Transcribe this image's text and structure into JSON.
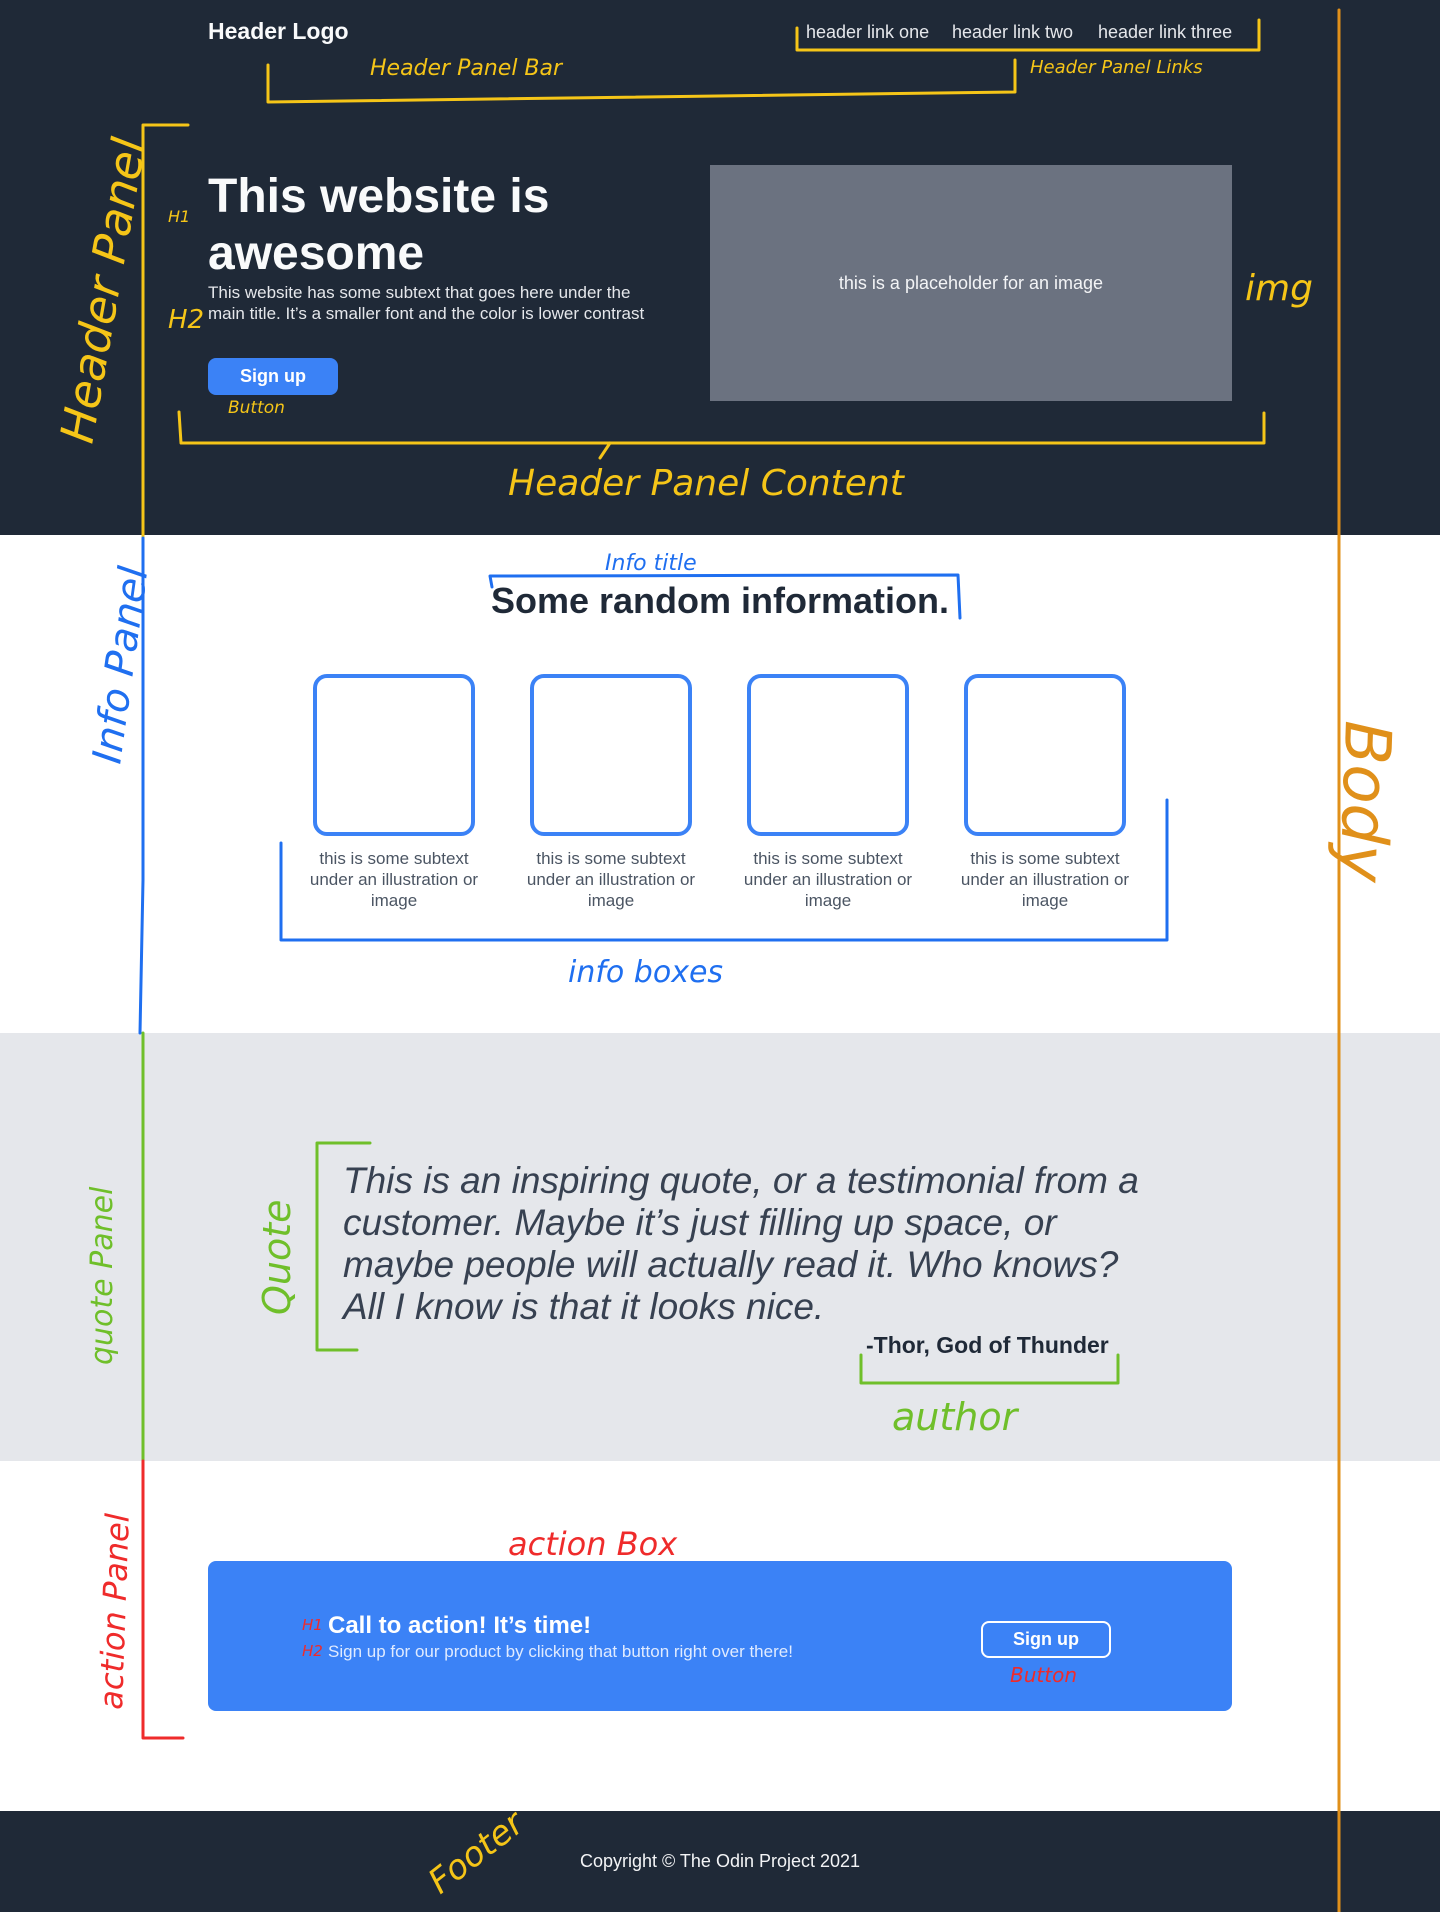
{
  "header": {
    "logo": "Header Logo",
    "links": [
      "header link one",
      "header link two",
      "header link three"
    ]
  },
  "hero": {
    "title": "This website is awesome",
    "subtitle": "This website has some subtext that goes here under the main title.  It’s a smaller font and the color is lower contrast",
    "button_label": "Sign up",
    "image_placeholder": "this is a placeholder for an image"
  },
  "info": {
    "title": "Some random information.",
    "captions": [
      "this is some subtext under an illustration or image",
      "this is some subtext under an illustration or image",
      "this is some subtext under an illustration or image",
      "this is some subtext under an illustration or image"
    ]
  },
  "quote": {
    "text": "This is an inspiring quote, or a testimonial from a customer.  Maybe it’s just filling up space, or maybe people will actually read it. Who knows?  All I know is that it looks nice.",
    "author": "-Thor, God of Thunder"
  },
  "cta": {
    "title": "Call to action! It’s time!",
    "subtitle": "Sign up for our product by clicking that button right over there!",
    "button_label": "Sign up"
  },
  "footer": {
    "copyright": "Copyright  ©  The Odin Project 2021"
  },
  "annotations": {
    "header_panel_bar": "Header Panel Bar",
    "header_panel_links": "Header Panel Links",
    "header_panel": "Header Panel",
    "h1": "H1",
    "h2": "H2",
    "button_hero": "Button",
    "img": "img",
    "header_panel_content": "Header Panel Content",
    "info_title": "Info title",
    "info_panel": "Info Panel",
    "info_boxes": "info boxes",
    "body": "Body",
    "quote_panel": "quote Panel",
    "quote": "Quote",
    "author": "author",
    "action_box": "action Box",
    "action_panel": "action Panel",
    "h1_cta": "H1",
    "h2_cta": "H2",
    "button_cta": "Button",
    "footer": "Footer"
  },
  "colors": {
    "dark": "#1f2937",
    "accent": "#3b82f6",
    "quote_bg": "#e5e7eb",
    "annotation_yellow": "#f5c518",
    "annotation_blue": "#1f6ff0",
    "annotation_green": "#6fbf2a",
    "annotation_red": "#ef2b2b",
    "annotation_orange": "#e0901a"
  }
}
